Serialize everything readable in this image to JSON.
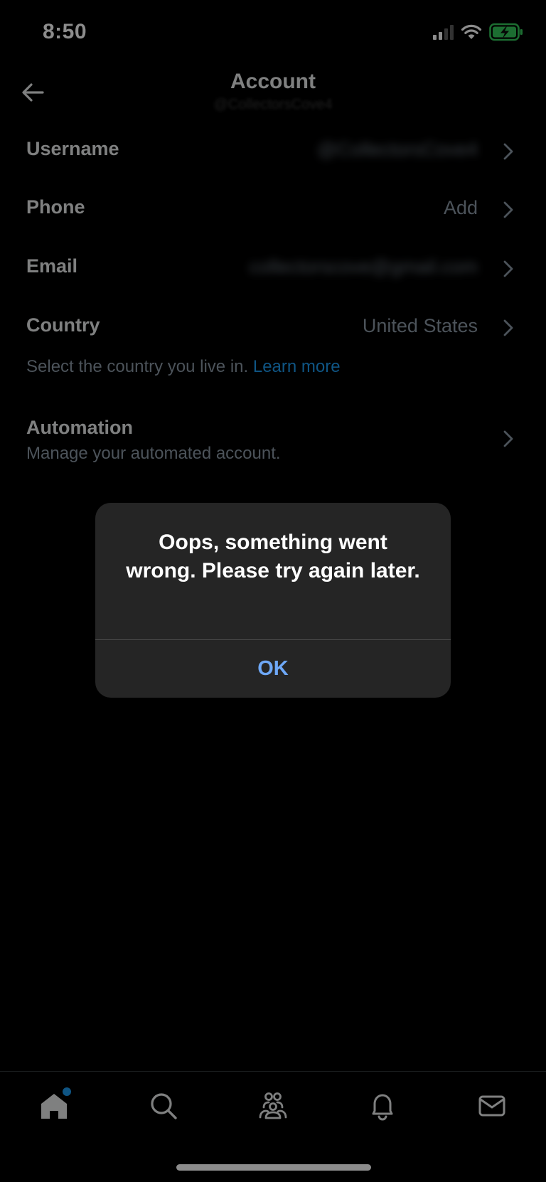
{
  "status_bar": {
    "time": "8:50"
  },
  "header": {
    "title": "Account",
    "subtitle": "@CollectorsCove4"
  },
  "rows": {
    "username": {
      "label": "Username",
      "value": "@CollectorsCove4"
    },
    "phone": {
      "label": "Phone",
      "value": "Add"
    },
    "email": {
      "label": "Email",
      "value": "collectorscove@gmail.com"
    },
    "country": {
      "label": "Country",
      "value": "United States"
    }
  },
  "country_help": {
    "text": "Select the country you live in.",
    "link": "Learn more"
  },
  "automation": {
    "label": "Automation",
    "description": "Manage your automated account."
  },
  "alert": {
    "message": "Oops, something went wrong. Please try again later.",
    "ok_label": "OK"
  },
  "tabs": [
    "home-icon",
    "search-icon",
    "communities-icon",
    "notifications-icon",
    "messages-icon"
  ],
  "colors": {
    "accent": "#1d9bf0",
    "alert_button": "#6ea8f7",
    "alert_bg": "#252525",
    "secondary_text": "#8b98a5"
  }
}
